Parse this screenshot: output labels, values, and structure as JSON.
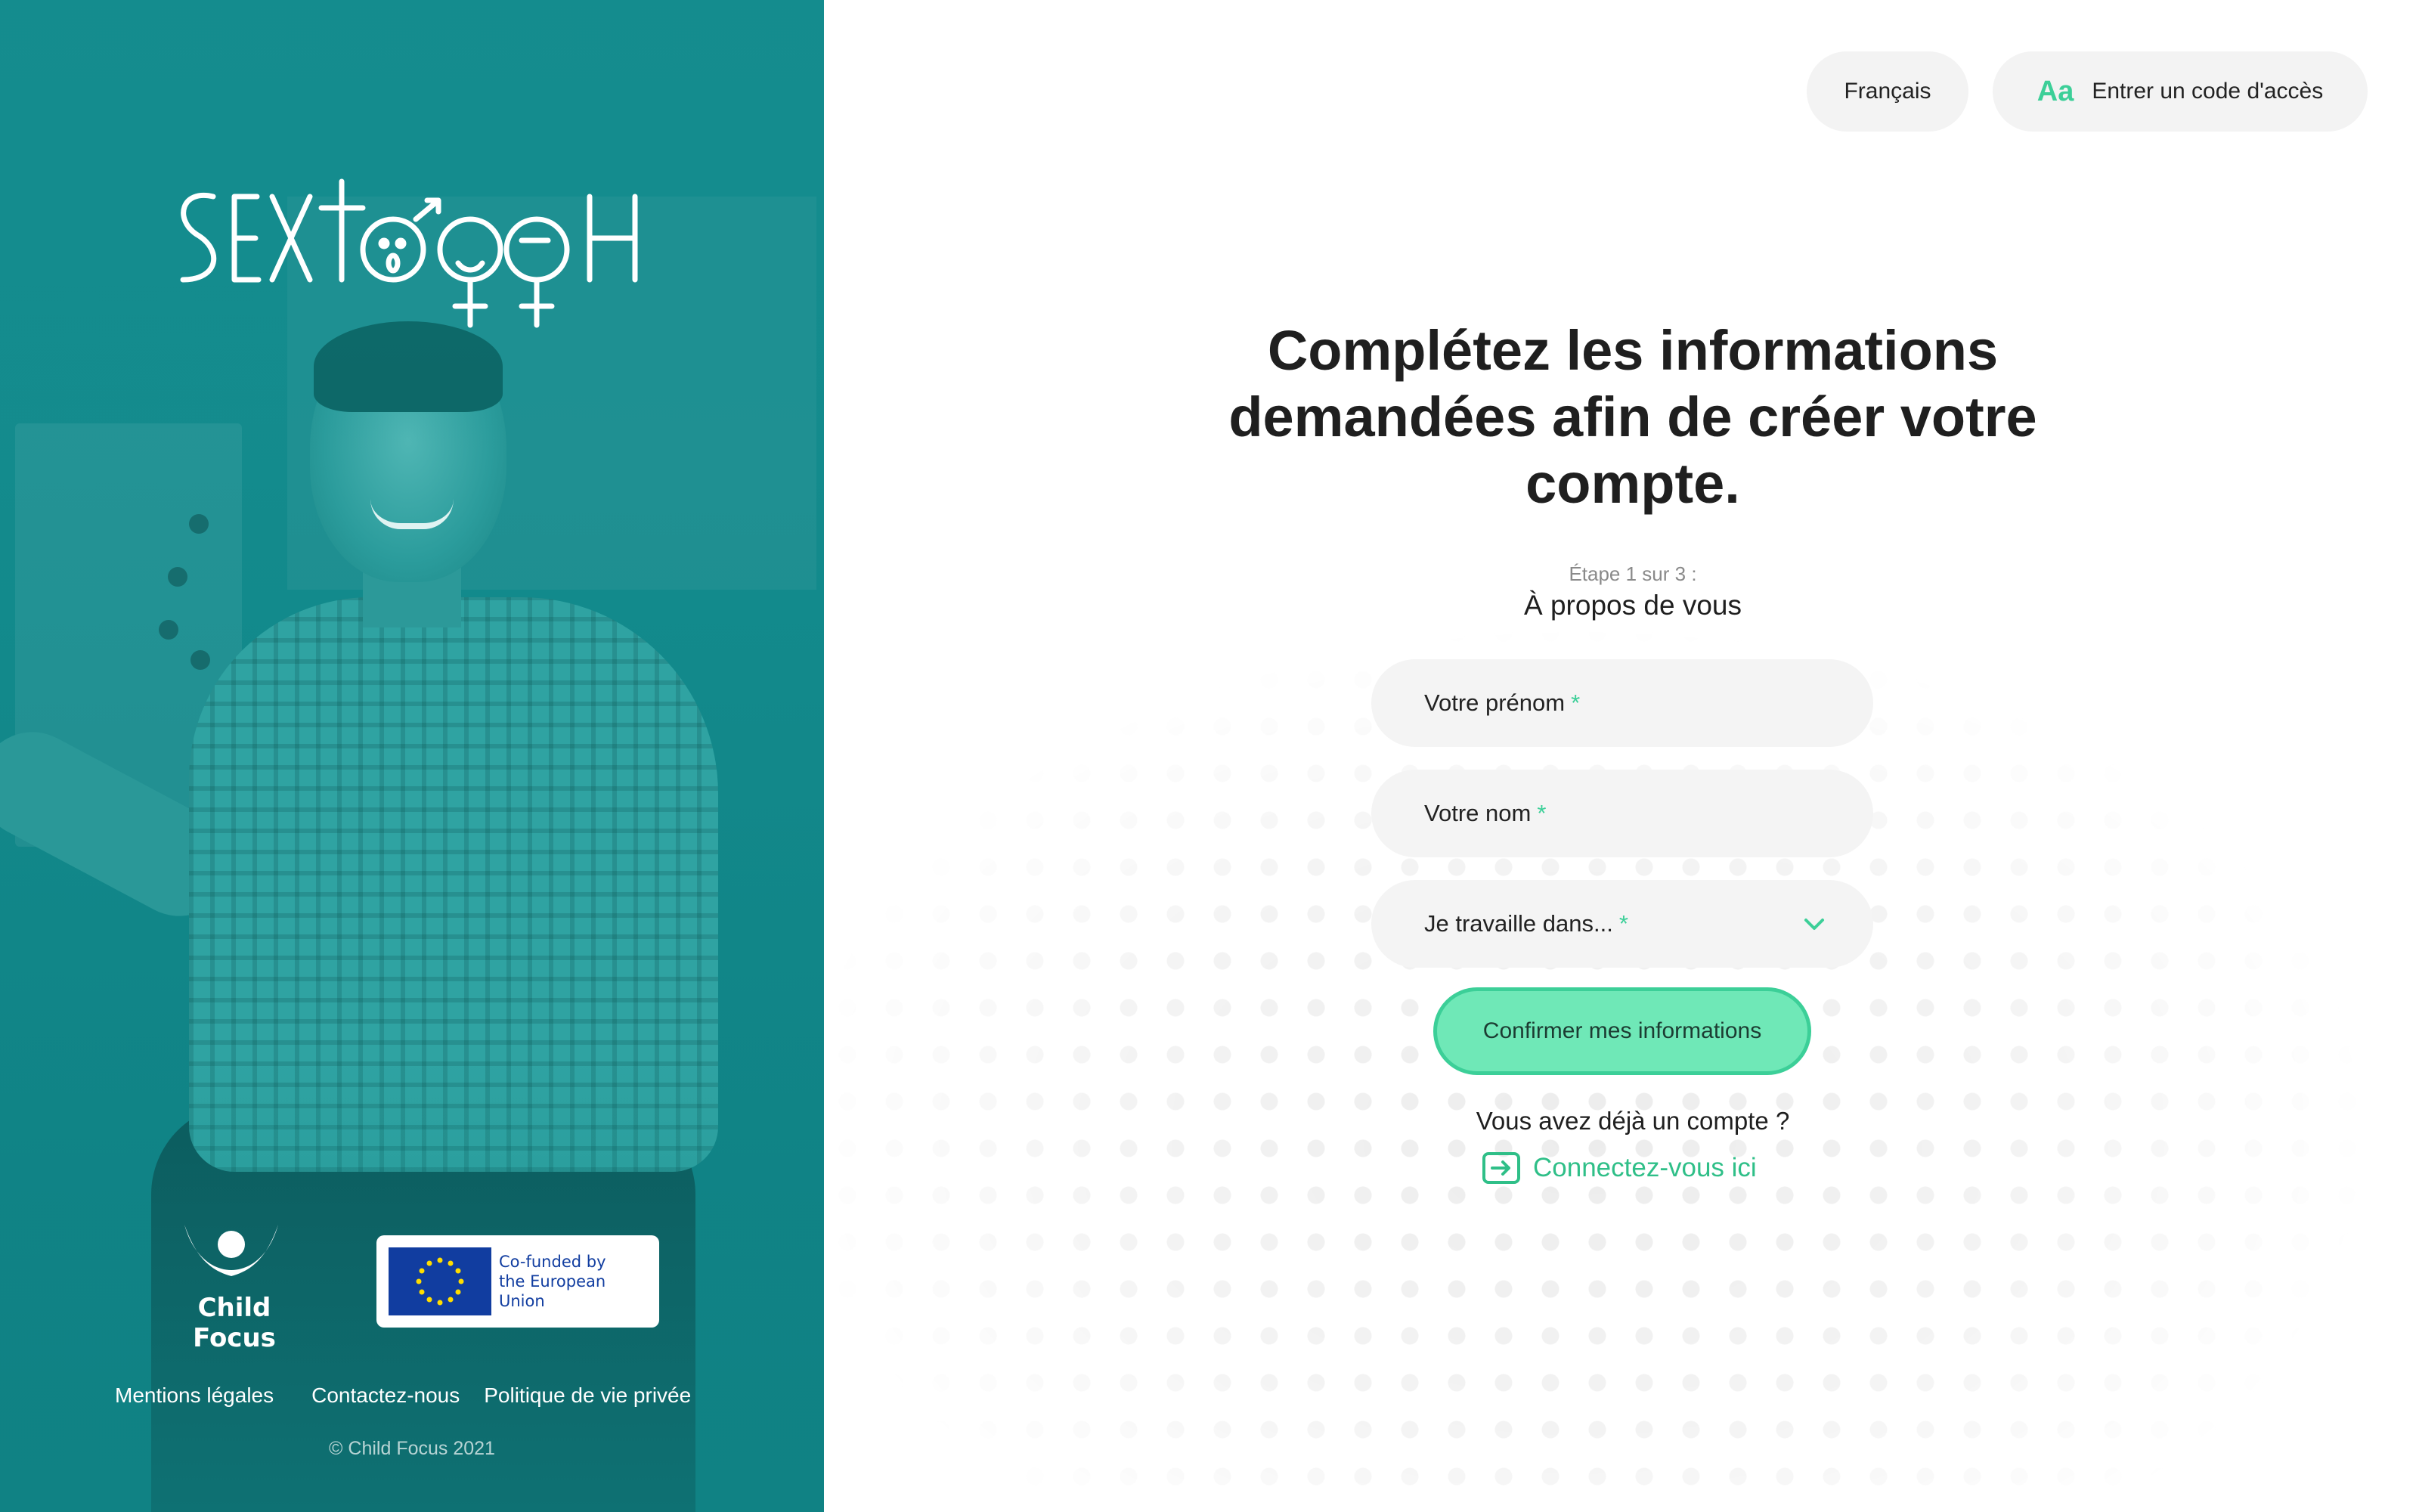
{
  "brand": {
    "logo_text": "SEXTOOOH",
    "partner_name": "Child Focus",
    "eu_text_line1": "Co-funded by",
    "eu_text_line2": "the European Union"
  },
  "footer": {
    "links": [
      "Mentions légales",
      "Contactez-nous",
      "Politique de vie privée"
    ],
    "copyright": "© Child Focus 2021"
  },
  "header": {
    "language_label": "Français",
    "access_code_label": "Entrer un code d'accès",
    "access_code_icon": "Aa"
  },
  "main": {
    "heading": "Complétez les informations demandées afin de créer votre compte.",
    "step_label": "Étape 1 sur 3 :",
    "step_title": "À propos de vous",
    "fields": {
      "first_name_placeholder": "Votre prénom",
      "last_name_placeholder": "Votre nom",
      "work_select_placeholder": "Je travaille dans...",
      "required_marker": "*"
    },
    "confirm_label": "Confirmer mes informations",
    "have_account_text": "Vous avez déjà un compte ?",
    "login_link_text": "Connectez-vous ici"
  },
  "colors": {
    "accent": "#3ccf98",
    "accent_fill": "#6fe8b7",
    "panel_teal": "#168f91",
    "field_bg": "#f4f4f4",
    "eu_blue": "#113da0",
    "eu_star": "#ffdd00"
  },
  "icons": {
    "chevron": "chevron-down-icon",
    "login": "login-icon",
    "text_size": "text-size-icon"
  }
}
